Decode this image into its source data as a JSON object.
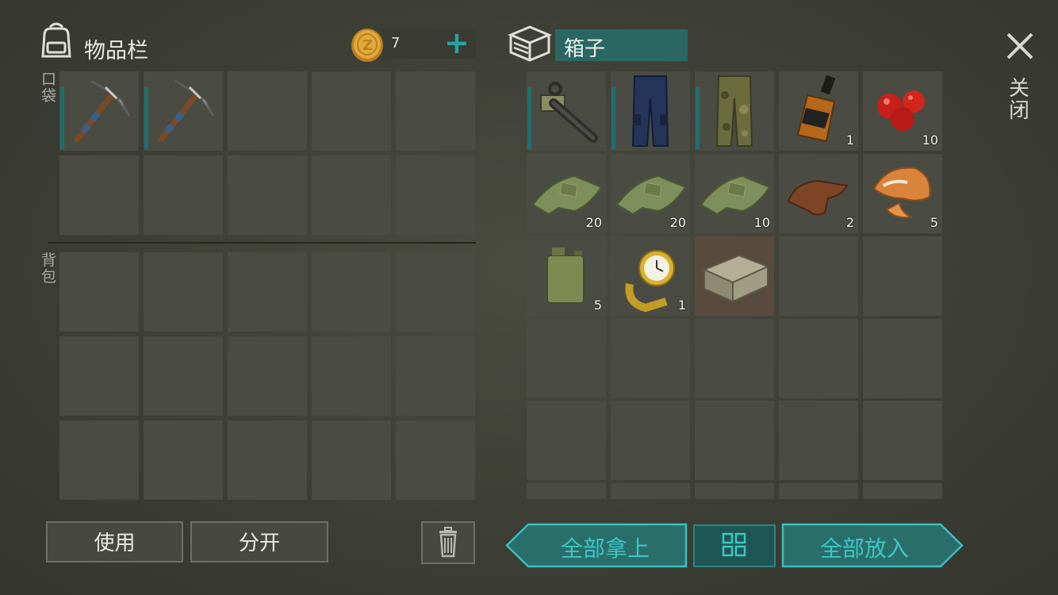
{
  "inventory": {
    "title": "物品栏",
    "coin_count": "7",
    "plus_label": "+",
    "pocket_label": "口袋",
    "backpack_label": "背包",
    "pocket_slots": [
      {
        "item": "pickaxe-icon",
        "qty": ""
      },
      {
        "item": "pickaxe-icon",
        "qty": ""
      }
    ]
  },
  "box": {
    "title": "箱子",
    "items": [
      {
        "item": "chainsaw-icon",
        "qty": ""
      },
      {
        "item": "blue-pants-icon",
        "qty": ""
      },
      {
        "item": "camo-pants-icon",
        "qty": ""
      },
      {
        "item": "whiskey-bottle-icon",
        "qty": "1"
      },
      {
        "item": "berries-icon",
        "qty": "10"
      },
      {
        "item": "cloth-icon",
        "qty": "20"
      },
      {
        "item": "cloth-icon",
        "qty": "20"
      },
      {
        "item": "cloth-icon",
        "qty": "10"
      },
      {
        "item": "leather-icon",
        "qty": "2"
      },
      {
        "item": "fox-fur-icon",
        "qty": "5"
      },
      {
        "item": "jerrycan-icon",
        "qty": "5"
      },
      {
        "item": "gold-watch-icon",
        "qty": "1"
      },
      {
        "item": "wooden-crate-icon",
        "qty": ""
      }
    ]
  },
  "buttons": {
    "use": "使用",
    "split": "分开",
    "take_all": "全部拿上",
    "put_all": "全部放入",
    "close": "关闭"
  },
  "colors": {
    "accent": "#27a3a3",
    "panel_slot": "#4a4c44",
    "box_title_bg": "#2a6763"
  }
}
